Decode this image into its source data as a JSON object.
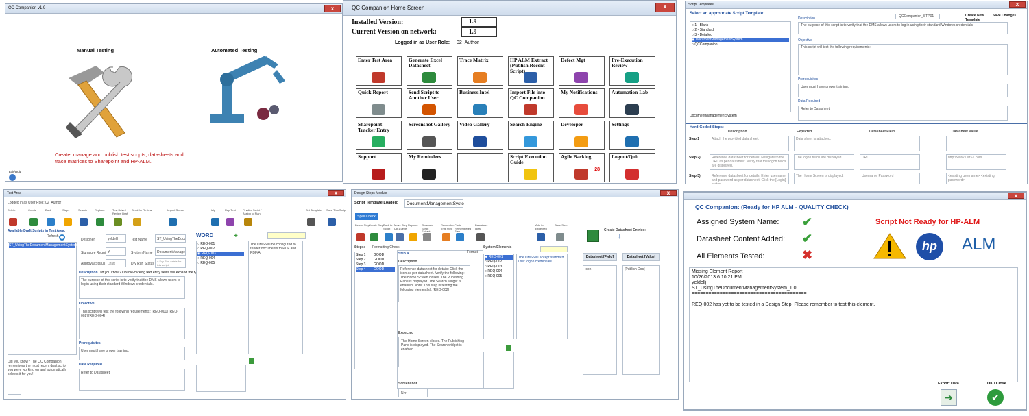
{
  "p1": {
    "title": "QC Companion v1.9",
    "manual": "Manual Testing",
    "automated": "Automated Testing",
    "desc": "Create, manage and publish test scripts, datasheets and trace matrices to Sharepoint and HP-ALM.",
    "exit": "Exit/Quit"
  },
  "p2": {
    "title": "QC Companion Home Screen",
    "installed_label": "Installed Version:",
    "installed_value": "1.9",
    "current_label": "Current Version on network:",
    "current_value": "1.9",
    "role_label": "Logged in as User Role:",
    "role_value": "02_Author",
    "tiles": [
      "Enter Test Area",
      "Generate  Excel Datasheet",
      "Trace Matrix",
      "HP ALM Extract (Publish Recent Script)",
      "Defect Mgt",
      "Pre-Execution Review",
      "Quick Report",
      "Send Script to Another User",
      "Business Intel",
      "Import File into QC Companion",
      "My Notifications",
      "Automation Lab",
      "Sharepoint Tracker Entry",
      "Screenshot Gallery",
      "Video Gallery",
      "Search Engine",
      "Developer",
      "Settings",
      "Support",
      "My Reminders",
      "",
      "Script Execution Guide",
      "Agile Backlog",
      "Logout/Quit"
    ],
    "backlog_count": "28",
    "sharepoint": "SharePoint"
  },
  "p3": {
    "title": "Script Templates",
    "select_label": "Select an appropriate Script Template:",
    "options": [
      "1 - Blank",
      "2 - Standard",
      "3 - Detailed",
      "DocumentManagementSystem",
      "QCCompanion"
    ],
    "selected_name": "DocumentManagementSystem",
    "desc_label": "Description",
    "script_field": "QCCompanion_STP01",
    "create_label": "Create New Template",
    "save_label": "Save Changes",
    "description": "The purpose of this script is to verify that the DMS allows users to log in using their standard Windows credentials.",
    "objective_label": "Objective",
    "objective": "This script will test the following requirements:",
    "prereq_label": "Prerequisites",
    "prereq": "User must have proper training.",
    "datareq_label": "Data Required",
    "datareq": "Refer to Datasheet.",
    "hard_label": "Hard-Coded Steps:",
    "cols": [
      "Description",
      "Expected",
      "Datasheet Field",
      "Datasheet Value"
    ],
    "steps": [
      {
        "n": "Step 1",
        "d": "Attach the provided data sheet.",
        "e": "Data sheet is attached.",
        "f": "",
        "v": ""
      },
      {
        "n": "Step 2)",
        "d": "Reference datasheet for details: Navigate to the URL as per datasheet. Verify that the logon fields are displayed.",
        "e": "The logon fields are displayed.",
        "f": "URL",
        "v": "http://www.DMS1.com"
      },
      {
        "n": "Step 3)",
        "d": "Reference datasheet for details: Enter username and password as per datasheet. Click the [Login] button.",
        "e": "The Home Screen is displayed.",
        "f": "Username Password",
        "v": "<existing username> <existing password>"
      }
    ]
  },
  "p4": {
    "title": "Test Area",
    "role": "Logged in as User Role:",
    "role_value": "02_Author",
    "tools": [
      "Delete",
      "Create",
      "Back",
      "Steps",
      "Search",
      "Replace",
      "Test Drive / Review Draft",
      "Send for Review",
      "Import Specs",
      "Help",
      "Rep Test",
      "Finalize Script / Assign to Plan",
      "Set Template",
      "Save This Script"
    ],
    "avail": "Available Draft Scripts in Test Area:",
    "refresh": "Refresh",
    "script": "ST_UsingTheDocumentManagementSystem_1.0",
    "designer_l": "Designer",
    "designer": "yeldelll",
    "testname_l": "Test Name",
    "testname": "ST_UsingTheDocumentMa",
    "sig_l": "Signature Required",
    "sig": "Y",
    "sys_l": "System Name",
    "sys": "DocumentManagementSys",
    "appr_l": "Approval Status",
    "appr": "Draft",
    "dry_l": "Dry Run Status",
    "dry": "A Dry Run exists for this script.",
    "desc_l": "Description",
    "tip": "Did you know? Double-clicking text entry fields will expand the typing area.",
    "desc": "The purpose of this script is to verify that the DMS allows users to log in using their standard Windows credentials.",
    "obj_l": "Objective",
    "obj": "This script will test the following requirements: [REQ-001] [REQ-002] [REQ-004]",
    "pre_l": "Prerequisites",
    "pre": "User must have proper training.",
    "data_l": "Data Required",
    "data": "Refer to Datasheet.",
    "word": "WORD",
    "reqs": [
      "REQ-001",
      "REQ-002",
      "REQ-003",
      "REQ-004",
      "REQ-005"
    ],
    "req_text": "The DMS will be configured to render documents to PDF and PDF/A.",
    "know": "Did you know? The QC Companion remembers the most recent draft script you were working on and automatically selects it for you!"
  },
  "p5": {
    "title": "Design Steps Module",
    "loaded_l": "Script Template Loaded:",
    "loaded": "DocumentManagementSyste",
    "spell": "Spell Check",
    "tools": [
      "Delete Step",
      "Create Step",
      "Back to Script",
      "Move Step Up 1 Level",
      "Replace",
      "Generate Script Extract Report",
      "Remember This Step",
      "Paste Remembered Step",
      "Datasheet Ideal",
      "Add to Expected",
      "Save Step"
    ],
    "steps_l": "Steps:",
    "fmt_l": "Formatting Check:",
    "steps": [
      [
        "Step 1",
        "GOOD"
      ],
      [
        "Step 2",
        "GOOD"
      ],
      [
        "Step 3",
        "GOOD"
      ],
      [
        "Step 4",
        "GOOD"
      ]
    ],
    "step4": "Step 4",
    "format": "Format",
    "desc_l": "Description",
    "desc": "Reference datasheet for details: Click the icon as per datasheet. Verify the following: The Home Screen closes. The Publishing Pane is displayed. The Search widget is enabled. Note: This step is testing the following element(s): [REQ-002]",
    "exp_l": "Expected",
    "exp": "The Home Screen closes. The Publishing Pane is displayed. The Search widget is enabled.",
    "shot_l": "Screenshot",
    "shot": "N",
    "sys_l": "System Elements",
    "reqs": [
      "REQ-001",
      "REQ-002",
      "REQ-003",
      "REQ-004",
      "REQ-005"
    ],
    "req_text": "The DMS will accept standard user logon credentials.",
    "create_l": "Create Datasheet Entries:",
    "ds_f": "Datasheet [Field]",
    "ds_v": "Datasheet [Value]",
    "f1": "Icon",
    "v1": "[Publish Doc]"
  },
  "p6": {
    "title": "QC Companion: (Ready for HP ALM - QUALITY CHECK)",
    "rows": [
      "Assigned System Name:",
      "Datasheet Content Added:",
      "All Elements Tested:"
    ],
    "notready": "Script Not Ready for HP-ALM",
    "hp": "hp",
    "alm": "ALM",
    "report": [
      "Missing Element Report",
      "10/26/2013 6:10:21 PM",
      "yeldellj",
      "ST_UsingTheDocumentManagementSystem_1.0",
      "=========================================",
      "",
      "REQ-002 has yet to be tested in a Design Step. Please remember to test this element."
    ],
    "export": "Export Data",
    "ok": "OK / Close"
  }
}
